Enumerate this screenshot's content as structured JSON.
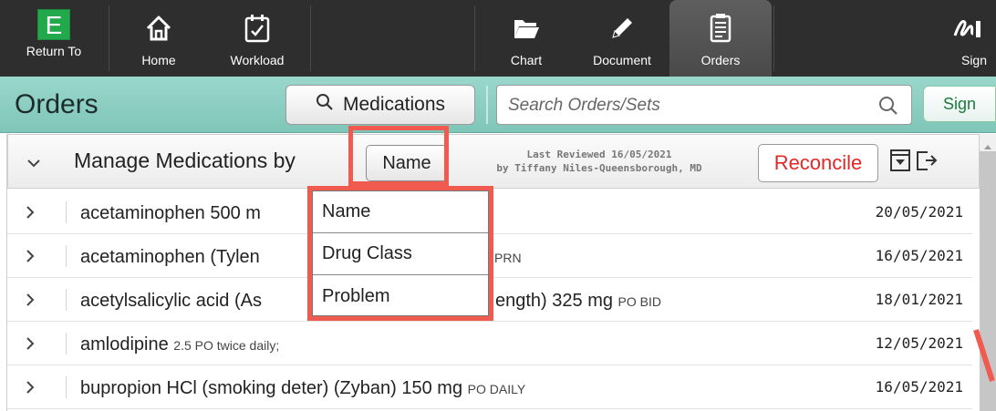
{
  "toolbar": {
    "items": [
      {
        "label": "Return To",
        "icon": "e-badge-icon"
      },
      {
        "label": "Home",
        "icon": "home-icon"
      },
      {
        "label": "Workload",
        "icon": "calendar-icon"
      },
      {
        "label": "Chart",
        "icon": "folder-icon"
      },
      {
        "label": "Document",
        "icon": "pencil-icon"
      },
      {
        "label": "Orders",
        "icon": "clipboard-icon",
        "active": true
      },
      {
        "label": "Sign",
        "icon": "signature-icon"
      }
    ],
    "badge_letter": "E"
  },
  "header": {
    "title": "Orders",
    "medications_label": "Medications",
    "search_placeholder": "Search Orders/Sets",
    "sign_label": "Sign"
  },
  "manage": {
    "label": "Manage Medications by",
    "sort_value": "Name",
    "last_reviewed_line1": "Last Reviewed 16/05/2021",
    "last_reviewed_line2": "by Tiffany Niles-Queensborough, MD",
    "reconcile_label": "Reconcile"
  },
  "dropdown": {
    "options": [
      "Name",
      "Drug Class",
      "Problem"
    ]
  },
  "medications": [
    {
      "name": "acetaminophen 500 m",
      "sig": "",
      "date": "20/05/2021"
    },
    {
      "name": "acetaminophen (Tylen",
      "sig": "",
      "trailing": "PRN",
      "date": "16/05/2021"
    },
    {
      "name": "acetylsalicylic acid (As",
      "trailing_main": "ength) 325 mg",
      "sig": "PO BID",
      "date": "18/01/2021"
    },
    {
      "name": "amlodipine",
      "sig": "2.5 PO twice daily;",
      "date": "12/05/2021"
    },
    {
      "name": "bupropion HCl (smoking deter) (Zyban) 150 mg",
      "sig": "PO DAILY",
      "date": "16/05/2021"
    }
  ],
  "colors": {
    "toolbar_bg": "#2e2e2e",
    "header_teal": "#8dcfc2",
    "highlight_red": "#f05a4f",
    "reconcile_red": "#e02828",
    "badge_green": "#22a94b"
  }
}
